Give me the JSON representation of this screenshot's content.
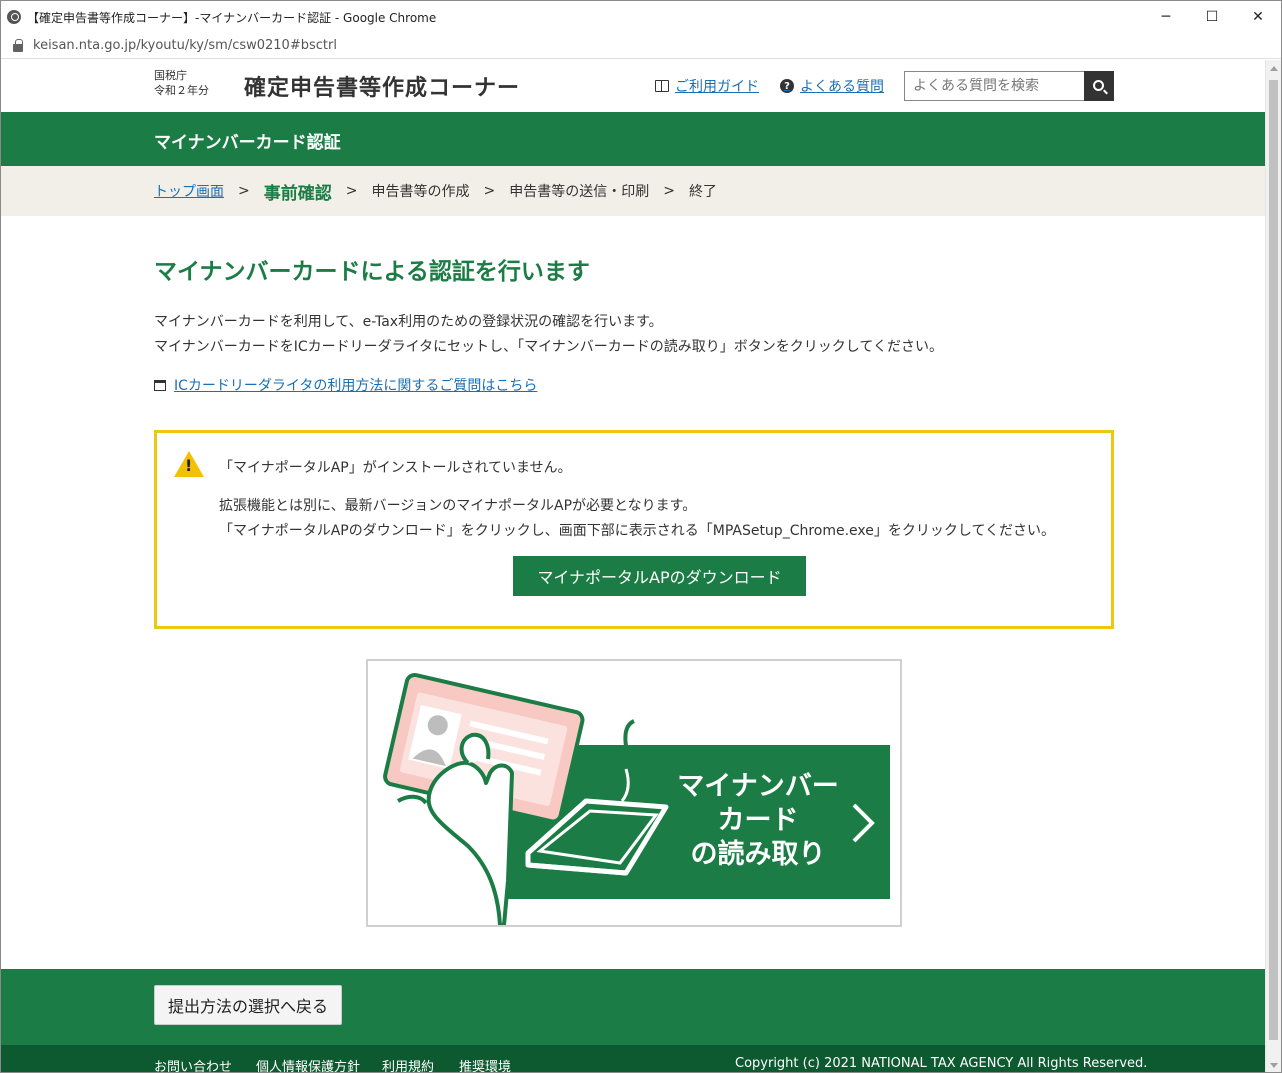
{
  "window": {
    "title": "【確定申告書等作成コーナー】-マイナンバーカード認証 - Google Chrome",
    "url": "keisan.nta.go.jp/kyoutu/ky/sm/csw0210#bsctrl",
    "controls": {
      "minimize": "─",
      "maximize": "☐",
      "close": "✕"
    }
  },
  "header": {
    "agency_line1": "国税庁",
    "agency_line2": "令和２年分",
    "site_title": "確定申告書等作成コーナー",
    "guide_link": "ご利用ガイド",
    "faq_link": "よくある質問",
    "search_placeholder": "よくある質問を検索"
  },
  "section_title": "マイナンバーカード認証",
  "breadcrumb": {
    "items": [
      "トップ画面",
      "事前確認",
      "申告書等の作成",
      "申告書等の送信・印刷",
      "終了"
    ],
    "separator": ">"
  },
  "main": {
    "heading": "マイナンバーカードによる認証を行います",
    "desc_line1": "マイナンバーカードを利用して、e-Tax利用のための登録状況の確認を行います。",
    "desc_line2": "マイナンバーカードをICカードリーダライタにセットし、「マイナンバーカードの読み取り」ボタンをクリックしてください。",
    "faq_link": "ICカードリーダライタの利用方法に関するご質問はこちら"
  },
  "alert": {
    "title": "「マイナポータルAP」がインストールされていません。",
    "body_line1": "拡張機能とは別に、最新バージョンのマイナポータルAPが必要となります。",
    "body_line2": "「マイナポータルAPのダウンロード」をクリックし、画面下部に表示される「MPASetup_Chrome.exe」をクリックしてください。",
    "download_button": "マイナポータルAPのダウンロード"
  },
  "card_reader_button": {
    "line1": "マイナンバー",
    "line2": "カード",
    "line3": "の読み取り"
  },
  "footer": {
    "back_button": "提出方法の選択へ戻る",
    "links": [
      "お問い合わせ",
      "個人情報保護方針",
      "利用規約",
      "推奨環境"
    ],
    "copyright": "Copyright (c) 2021 NATIONAL TAX AGENCY All Rights Reserved."
  },
  "colors": {
    "brand_green": "#1b7d45",
    "dark_green": "#0e5a30",
    "alert_border": "#ecc814",
    "link_blue": "#1a6fb5",
    "breadcrumb_bg": "#f1efe7"
  }
}
